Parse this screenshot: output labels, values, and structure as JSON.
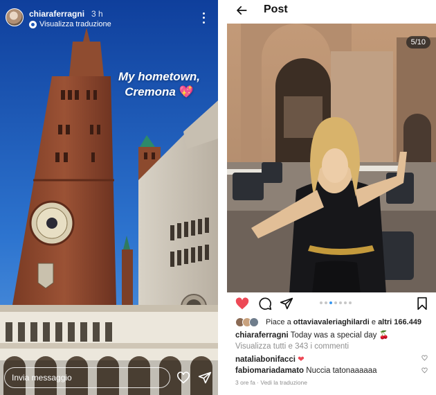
{
  "story": {
    "username": "chiaraferragni",
    "time": "3 h",
    "translate_label": "Visualizza traduzione",
    "caption_line1": "My hometown,",
    "caption_line2": "Cremona",
    "caption_emoji": "💖",
    "reply_placeholder": "Invia messaggio",
    "icons": [
      "more-icon",
      "heart-outline-icon",
      "send-icon"
    ]
  },
  "post": {
    "header_title": "Post",
    "carousel_counter": "5/10",
    "carousel_total_dots": 7,
    "carousel_active_dot": 2,
    "likes_prefix": "Piace a",
    "likes_user": "ottaviavaleriaghilardi",
    "likes_connector": "e",
    "likes_others": "altri 166.449",
    "caption_user": "chiaraferragni",
    "caption_text": "Today was a special day",
    "caption_emoji": "🍒",
    "view_comments": "Visualizza tutti e 343 i commenti",
    "comments": [
      {
        "user": "nataliabonifacci",
        "text": "❤"
      },
      {
        "user": "fabiomariadamato",
        "text": "Nuccia tatonaaaaaa"
      }
    ],
    "meta": "3 ore fa · Vedi la traduzione",
    "colors": {
      "like_red": "#ed4956",
      "link_blue": "#3897f0",
      "muted": "#8e8e8e"
    }
  }
}
